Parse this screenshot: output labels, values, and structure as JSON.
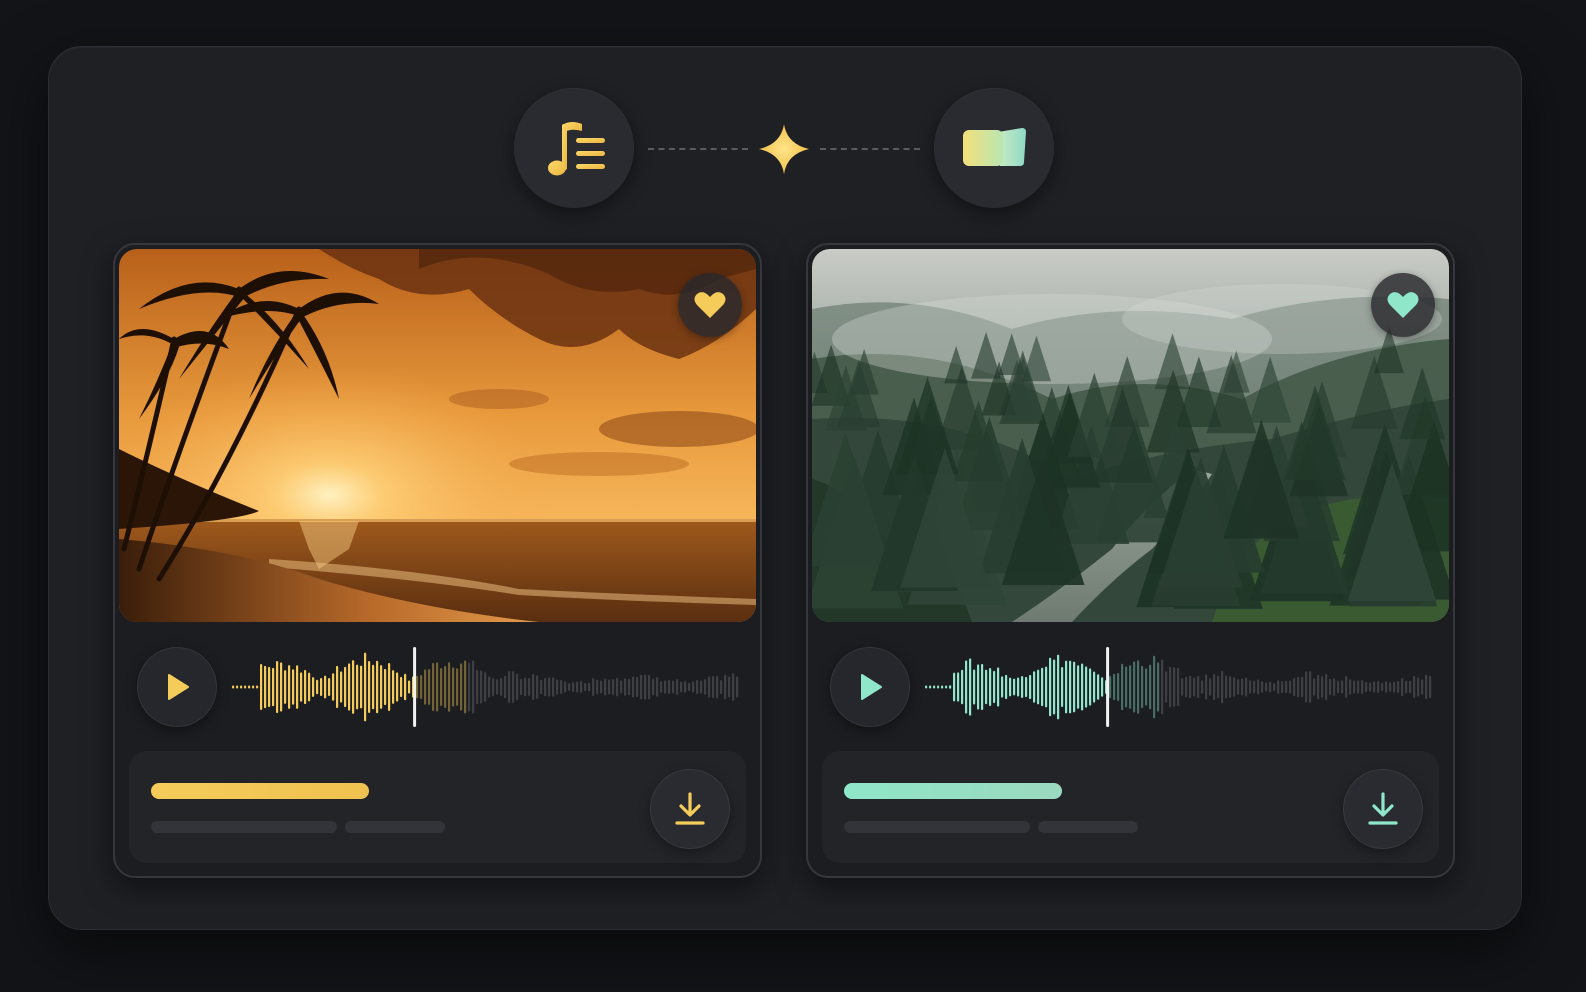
{
  "header": {
    "music_icon": "music-list-icon",
    "spark_icon": "sparkle-icon",
    "cards_icon": "cards-icon"
  },
  "accent_colors": {
    "gold": "#f5cc5a",
    "mint": "#8fe6c8"
  },
  "cards": [
    {
      "scene": "beach-sunset",
      "accent": "#f5cc5a",
      "favorite_icon": "heart-icon",
      "play_icon": "play-icon",
      "download_icon": "download-icon",
      "playback_progress": 0.36
    },
    {
      "scene": "misty-forest-river",
      "accent": "#8fe6c8",
      "favorite_icon": "heart-icon",
      "play_icon": "play-icon",
      "download_icon": "download-icon",
      "playback_progress": 0.36
    }
  ]
}
